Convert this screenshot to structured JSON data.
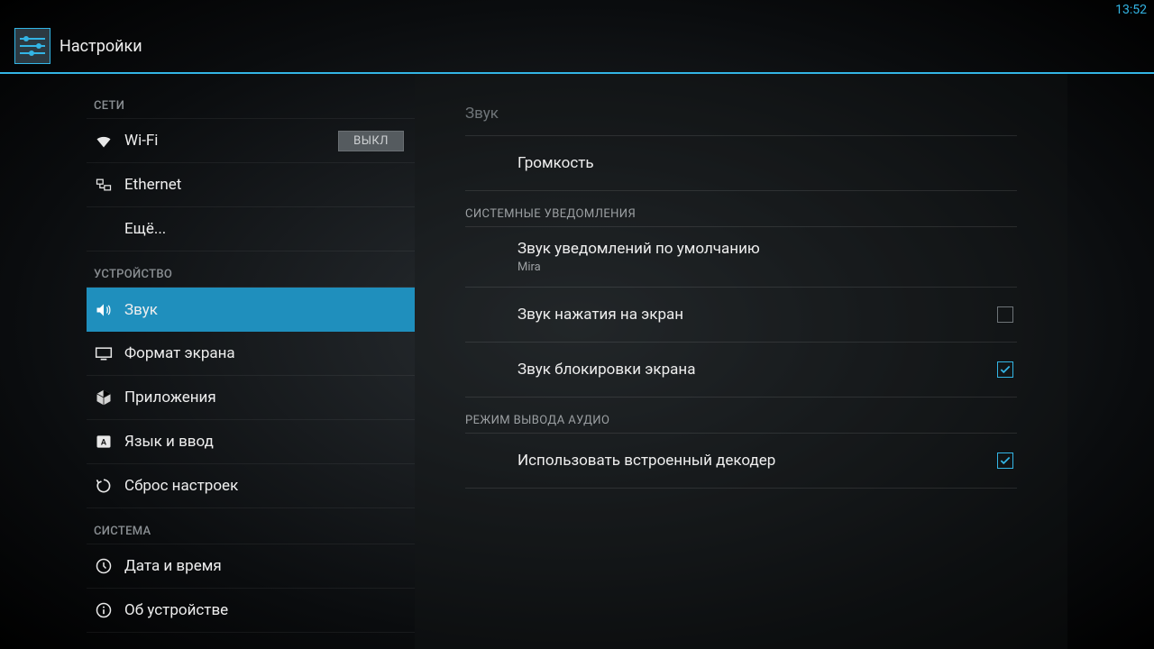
{
  "status": {
    "time": "13:52"
  },
  "header": {
    "title": "Настройки"
  },
  "sidebar": {
    "sections": {
      "networks": {
        "title": "СЕТИ",
        "wifi": {
          "label": "Wi-Fi",
          "toggle": "ВЫКЛ"
        },
        "ethernet": {
          "label": "Ethernet"
        },
        "more": {
          "label": "Ещё..."
        }
      },
      "device": {
        "title": "УСТРОЙСТВО",
        "sound": {
          "label": "Звук"
        },
        "display": {
          "label": "Формат экрана"
        },
        "apps": {
          "label": "Приложения"
        },
        "language": {
          "label": "Язык и ввод"
        },
        "reset": {
          "label": "Сброс настроек"
        }
      },
      "system": {
        "title": "СИСТЕМА",
        "datetime": {
          "label": "Дата и время"
        },
        "about": {
          "label": "Об устройстве"
        }
      }
    }
  },
  "details": {
    "title": "Звук",
    "volume": {
      "label": "Громкость"
    },
    "section_notifications": "СИСТЕМНЫЕ УВЕДОМЛЕНИЯ",
    "default_notification": {
      "label": "Звук уведомлений по умолчанию",
      "value": "Mira"
    },
    "touch_sound": {
      "label": "Звук нажатия на экран",
      "checked": false
    },
    "lock_sound": {
      "label": "Звук блокировки экрана",
      "checked": true
    },
    "section_audio_out": "РЕЖИМ ВЫВОДА АУДИО",
    "builtin_decoder": {
      "label": "Использовать встроенный декодер",
      "checked": true
    }
  }
}
